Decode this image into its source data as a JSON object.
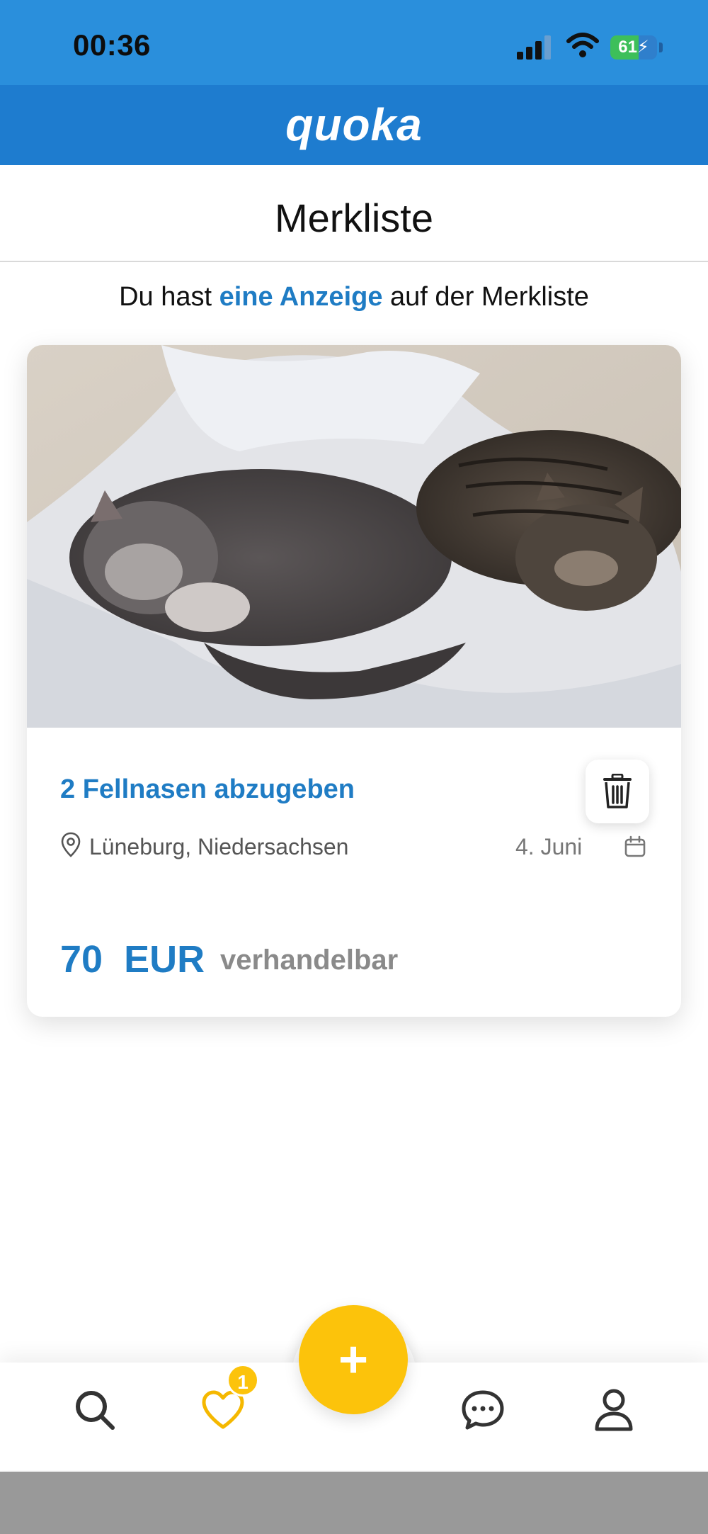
{
  "status_bar": {
    "time": "00:36",
    "battery_percent": 61,
    "battery_label": "61",
    "signal_bars": 3,
    "wifi_icon": "wifi-icon",
    "color": "#2a8fdc"
  },
  "brand": {
    "logo_text": "quoka",
    "color": "#1e7ccf"
  },
  "page": {
    "title": "Merkliste",
    "summary_prefix": "Du hast ",
    "summary_link": "eine Anzeige",
    "summary_suffix": " auf der Merkliste"
  },
  "listing": {
    "image_alt": "Zwei schlafende Katzen auf einer Decke",
    "title": "2 Fellnasen abzugeben",
    "location": "Lüneburg, Niedersachsen",
    "date": "4. Juni",
    "price": "70  EUR",
    "price_note": "verhandelbar",
    "delete_icon": "trash-icon",
    "location_icon": "map-pin-icon",
    "date_icon": "calendar-icon"
  },
  "bottom_nav": {
    "items": [
      {
        "name": "search",
        "icon": "search-icon"
      },
      {
        "name": "favorites",
        "icon": "heart-icon",
        "badge": "1",
        "active": true
      },
      {
        "name": "messages",
        "icon": "chat-icon"
      },
      {
        "name": "profile",
        "icon": "user-icon"
      }
    ],
    "fab_label": "+",
    "fab_color": "#fcc30b",
    "accent": "#1f7cc4"
  }
}
